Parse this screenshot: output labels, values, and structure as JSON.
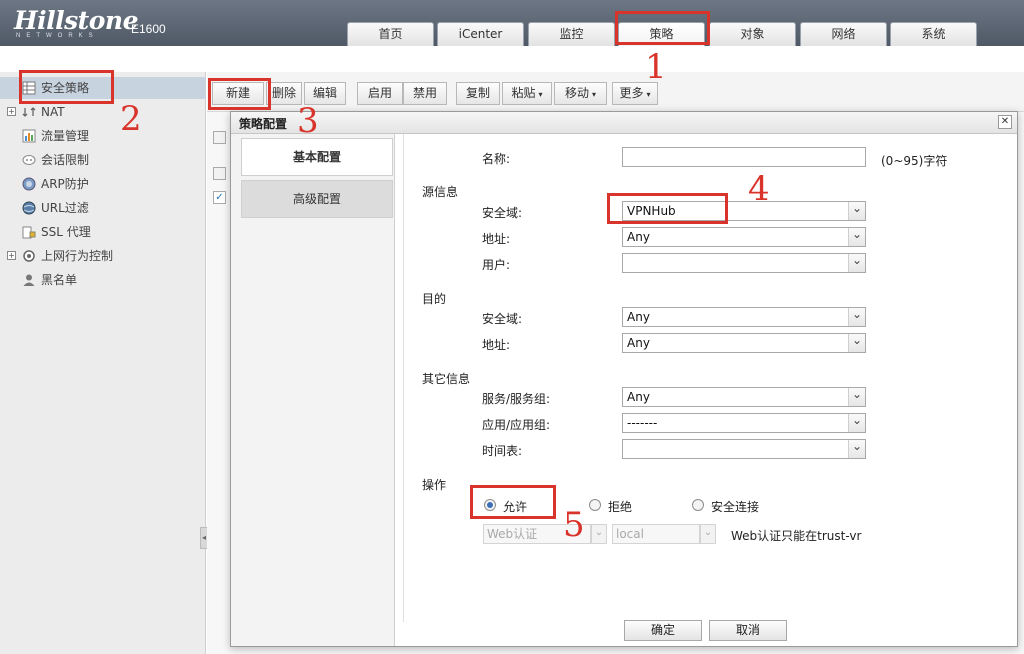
{
  "header": {
    "logo": "Hillstone",
    "logo_sub": "NETWORKS",
    "model": "E1600",
    "tabs": [
      "首页",
      "iCenter",
      "监控",
      "策略",
      "对象",
      "网络",
      "系统"
    ],
    "active_tab": "策略"
  },
  "sidebar": {
    "items": [
      {
        "label": "安全策略",
        "icon": "grid-icon"
      },
      {
        "label": "NAT",
        "icon": "nat-icon"
      },
      {
        "label": "流量管理",
        "icon": "traffic-icon"
      },
      {
        "label": "会话限制",
        "icon": "session-icon"
      },
      {
        "label": "ARP防护",
        "icon": "shield-icon"
      },
      {
        "label": "URL过滤",
        "icon": "globe-icon"
      },
      {
        "label": "SSL 代理",
        "icon": "ssl-icon"
      },
      {
        "label": "上网行为控制",
        "icon": "behavior-icon"
      },
      {
        "label": "黑名单",
        "icon": "user-icon"
      }
    ]
  },
  "toolbar": {
    "new": "新建",
    "delete": "删除",
    "edit": "编辑",
    "enable": "启用",
    "disable": "禁用",
    "copy": "复制",
    "paste": "粘贴",
    "move": "移动",
    "more": "更多"
  },
  "dialog": {
    "title": "策略配置",
    "tabs": [
      "基本配置",
      "高级配置"
    ],
    "name_label": "名称:",
    "name_value": "",
    "name_hint": "(0~95)字符",
    "source_section": "源信息",
    "src_zone_label": "安全域:",
    "src_zone_value": "VPNHub",
    "src_addr_label": "地址:",
    "src_addr_value": "Any",
    "src_user_label": "用户:",
    "src_user_value": "",
    "dest_section": "目的",
    "dst_zone_label": "安全域:",
    "dst_zone_value": "Any",
    "dst_addr_label": "地址:",
    "dst_addr_value": "Any",
    "other_section": "其它信息",
    "service_label": "服务/服务组:",
    "service_value": "Any",
    "app_label": "应用/应用组:",
    "app_value": "-------",
    "schedule_label": "时间表:",
    "schedule_value": "",
    "action_section": "操作",
    "actions": [
      "允许",
      "拒绝",
      "安全连接"
    ],
    "selected_action": "允许",
    "web_auth_value": "Web认证",
    "local_value": "local",
    "web_auth_note": "Web认证只能在trust-vr",
    "ok": "确定",
    "cancel": "取消"
  },
  "annotations": [
    "1",
    "2",
    "3",
    "4",
    "5"
  ],
  "colors": {
    "annotation": "#d9342b",
    "header": "#5d6775",
    "selected_side": "#c8d3e0",
    "radio_on": "#3b6fb5"
  }
}
